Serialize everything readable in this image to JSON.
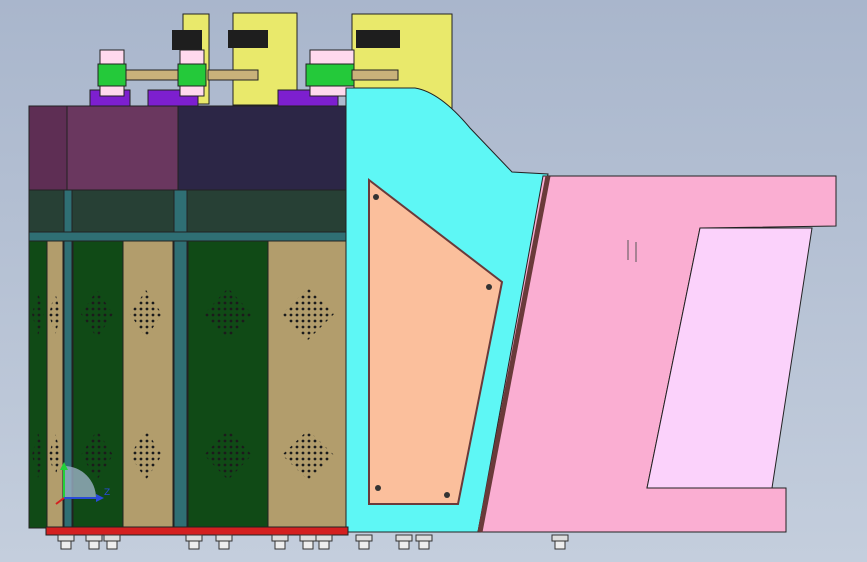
{
  "viewport": {
    "background": {
      "top": "#a9b6cc",
      "bottom": "#c4cedd"
    }
  },
  "colors": {
    "cabinet_top_left": "#5e2e54",
    "cabinet_top_mid": "#6a375f",
    "cabinet_top_right": "#2c2646",
    "cabinet_band": "#274035",
    "panel_green": "#104a16",
    "panel_tan": "#b29d6c",
    "post_teal": "#2f6f74",
    "cyan_frame": "#5ef7f5",
    "plate_peach": "#fbbf9c",
    "pink_body": "#faaed2",
    "pink_window": "#fbd2fb",
    "yellow_part": "#e9e96b",
    "base_strip_red": "#d42020",
    "purple_part": "#7d1fcf",
    "green_ring": "#24c93a",
    "pink_ring": "#ffd9ee",
    "divider_brown": "#6a3a3a"
  },
  "triad": {
    "x_label": "",
    "y_label": "",
    "z_label": "Z",
    "icons": [
      "axis-triad-icon"
    ]
  }
}
